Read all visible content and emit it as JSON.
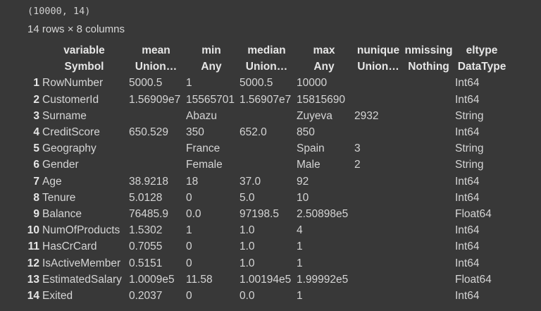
{
  "output": {
    "shape_line": "(10000, 14)",
    "summary_line": "14 rows × 8 columns"
  },
  "table": {
    "header_names": [
      "variable",
      "mean",
      "min",
      "median",
      "max",
      "nunique",
      "nmissing",
      "eltype"
    ],
    "header_types": [
      "Symbol",
      "Union…",
      "Any",
      "Union…",
      "Any",
      "Union…",
      "Nothing",
      "DataType"
    ],
    "rows": [
      {
        "idx": "1",
        "variable": "RowNumber",
        "mean": "5000.5",
        "min": "1",
        "median": "5000.5",
        "max": "10000",
        "nunique": "",
        "nmissing": "",
        "eltype": "Int64"
      },
      {
        "idx": "2",
        "variable": "CustomerId",
        "mean": "1.56909e7",
        "min": "15565701",
        "median": "1.56907e7",
        "max": "15815690",
        "nunique": "",
        "nmissing": "",
        "eltype": "Int64"
      },
      {
        "idx": "3",
        "variable": "Surname",
        "mean": "",
        "min": "Abazu",
        "median": "",
        "max": "Zuyeva",
        "nunique": "2932",
        "nmissing": "",
        "eltype": "String"
      },
      {
        "idx": "4",
        "variable": "CreditScore",
        "mean": "650.529",
        "min": "350",
        "median": "652.0",
        "max": "850",
        "nunique": "",
        "nmissing": "",
        "eltype": "Int64"
      },
      {
        "idx": "5",
        "variable": "Geography",
        "mean": "",
        "min": "France",
        "median": "",
        "max": "Spain",
        "nunique": "3",
        "nmissing": "",
        "eltype": "String"
      },
      {
        "idx": "6",
        "variable": "Gender",
        "mean": "",
        "min": "Female",
        "median": "",
        "max": "Male",
        "nunique": "2",
        "nmissing": "",
        "eltype": "String"
      },
      {
        "idx": "7",
        "variable": "Age",
        "mean": "38.9218",
        "min": "18",
        "median": "37.0",
        "max": "92",
        "nunique": "",
        "nmissing": "",
        "eltype": "Int64"
      },
      {
        "idx": "8",
        "variable": "Tenure",
        "mean": "5.0128",
        "min": "0",
        "median": "5.0",
        "max": "10",
        "nunique": "",
        "nmissing": "",
        "eltype": "Int64"
      },
      {
        "idx": "9",
        "variable": "Balance",
        "mean": "76485.9",
        "min": "0.0",
        "median": "97198.5",
        "max": "2.50898e5",
        "nunique": "",
        "nmissing": "",
        "eltype": "Float64"
      },
      {
        "idx": "10",
        "variable": "NumOfProducts",
        "mean": "1.5302",
        "min": "1",
        "median": "1.0",
        "max": "4",
        "nunique": "",
        "nmissing": "",
        "eltype": "Int64"
      },
      {
        "idx": "11",
        "variable": "HasCrCard",
        "mean": "0.7055",
        "min": "0",
        "median": "1.0",
        "max": "1",
        "nunique": "",
        "nmissing": "",
        "eltype": "Int64"
      },
      {
        "idx": "12",
        "variable": "IsActiveMember",
        "mean": "0.5151",
        "min": "0",
        "median": "1.0",
        "max": "1",
        "nunique": "",
        "nmissing": "",
        "eltype": "Int64"
      },
      {
        "idx": "13",
        "variable": "EstimatedSalary",
        "mean": "1.0009e5",
        "min": "11.58",
        "median": "1.00194e5",
        "max": "1.99992e5",
        "nunique": "",
        "nmissing": "",
        "eltype": "Float64"
      },
      {
        "idx": "14",
        "variable": "Exited",
        "mean": "0.2037",
        "min": "0",
        "median": "0.0",
        "max": "1",
        "nunique": "",
        "nmissing": "",
        "eltype": "Int64"
      }
    ]
  }
}
